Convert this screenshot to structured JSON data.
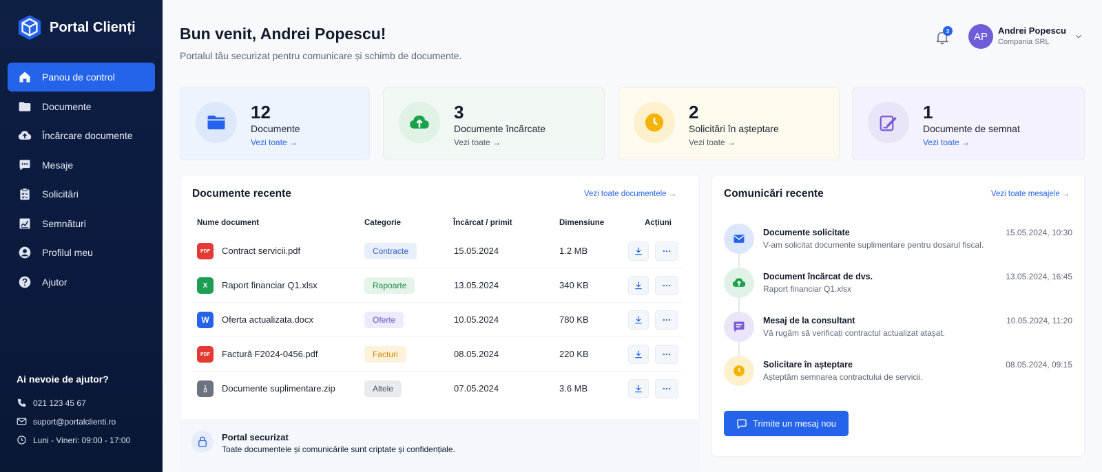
{
  "brand": {
    "name": "Portal Clienți"
  },
  "sidebar": {
    "items": [
      {
        "label": "Panou de control",
        "icon": "home-icon",
        "active": true
      },
      {
        "label": "Documente",
        "icon": "folder-icon"
      },
      {
        "label": "Încărcare documente",
        "icon": "cloud-upload-icon"
      },
      {
        "label": "Mesaje",
        "icon": "chat-icon"
      },
      {
        "label": "Solicitări",
        "icon": "clipboard-icon"
      },
      {
        "label": "Semnături",
        "icon": "signature-icon"
      },
      {
        "label": "Profilul meu",
        "icon": "user-circle-icon"
      },
      {
        "label": "Ajutor",
        "icon": "help-icon"
      }
    ],
    "help": {
      "title": "Ai nevoie de ajutor?",
      "phone": "021 123 45 67",
      "email": "suport@portalclienti.ro",
      "hours": "Luni - Vineri: 09:00 - 17:00"
    }
  },
  "header": {
    "title": "Bun venit, Andrei Popescu!",
    "subtitle": "Portalul tău securizat pentru comunicare și schimb de documente.",
    "notifications": "3",
    "user": {
      "initials": "AP",
      "name": "Andrei Popescu",
      "company": "Compania SRL"
    }
  },
  "stats": [
    {
      "value": "12",
      "label": "Documente",
      "link": "Vezi toate →",
      "color": "#2563eb"
    },
    {
      "value": "3",
      "label": "Documente încărcate",
      "link": "Vezi toate →",
      "color": "#16a34a"
    },
    {
      "value": "2",
      "label": "Solicitări în așteptare",
      "link": "Vezi toate →",
      "color": "#f5b301"
    },
    {
      "value": "1",
      "label": "Documente de semnat",
      "link": "Vezi toate →",
      "color": "#7c5cd6"
    }
  ],
  "recent_docs": {
    "title": "Documente recente",
    "link": "Vezi toate documentele →",
    "columns": [
      "Nume document",
      "Categorie",
      "Încărcat / primit",
      "Dimensiune",
      "Acțiuni"
    ],
    "rows": [
      {
        "name": "Contract servicii.pdf",
        "type": "pdf",
        "badge": "PDF",
        "category": "Contracte",
        "date": "15.05.2024",
        "size": "1.2 MB"
      },
      {
        "name": "Raport financiar Q1.xlsx",
        "type": "xls",
        "badge": "X",
        "category": "Rapoarte",
        "date": "13.05.2024",
        "size": "340 KB"
      },
      {
        "name": "Oferta actualizata.docx",
        "type": "doc",
        "badge": "W",
        "category": "Oferte",
        "date": "10.05.2024",
        "size": "780 KB"
      },
      {
        "name": "Factură F2024-0456.pdf",
        "type": "pdf",
        "badge": "PDF",
        "category": "Facturi",
        "date": "08.05.2024",
        "size": "220 KB"
      },
      {
        "name": "Documente suplimentare.zip",
        "type": "zip",
        "badge": "",
        "category": "Altele",
        "date": "07.05.2024",
        "size": "3.6 MB"
      }
    ]
  },
  "secure": {
    "title": "Portal securizat",
    "text": "Toate documentele și comunicările sunt criptate și confidențiale."
  },
  "communications": {
    "title": "Comunicări recente",
    "link": "Vezi toate mesajele →",
    "items": [
      {
        "title": "Documente solicitate",
        "desc": "V-am solicitat documente suplimentare pentru dosarul fiscal.",
        "date": "15.05.2024, 10:30",
        "icon": "mail-icon"
      },
      {
        "title": "Document încărcat de dvs.",
        "desc": "Raport financiar Q1.xlsx",
        "date": "13.05.2024, 16:45",
        "icon": "cloud-upload-icon"
      },
      {
        "title": "Mesaj de la consultant",
        "desc": "Vă rugăm să verificați contractul actualizat atașat.",
        "date": "10.05.2024, 11:20",
        "icon": "message-icon"
      },
      {
        "title": "Solicitare în așteptare",
        "desc": "Așteptăm semnarea contractului de servicii.",
        "date": "08.05.2024, 09:15",
        "icon": "clock-icon"
      }
    ],
    "button": "Trimite un mesaj nou"
  }
}
